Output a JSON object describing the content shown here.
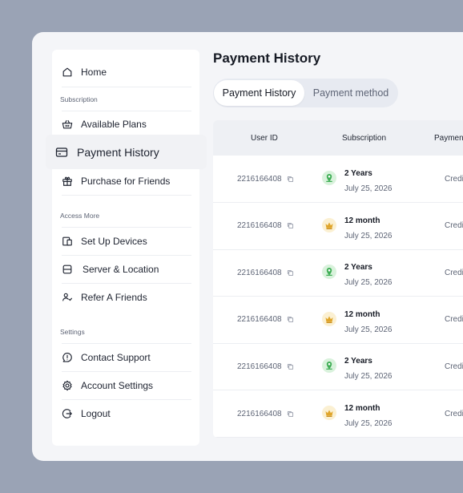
{
  "sidebar": {
    "home": "Home",
    "section_subscription": "Subscription",
    "available_plans": "Available Plans",
    "payment_history": "Payment History",
    "purchase_for_friends": "Purchase for Friends",
    "section_access_more": "Access More",
    "set_up_devices": "Set Up Devices",
    "server_location": "Server & Location",
    "refer_friends": "Refer A Friends",
    "section_settings": "Settings",
    "contact_support": "Contact Support",
    "account_settings": "Account Settings",
    "logout": "Logout"
  },
  "main": {
    "title": "Payment History",
    "tabs": [
      {
        "label": "Payment History",
        "active": true
      },
      {
        "label": "Payment method",
        "active": false
      }
    ],
    "table": {
      "headers": [
        "User ID",
        "Subscription",
        "Payment"
      ],
      "rows": [
        {
          "user_id": "2216166408",
          "plan": "2 Years",
          "date": "July 25, 2026",
          "badge": "green",
          "payment": "Credi"
        },
        {
          "user_id": "2216166408",
          "plan": "12 month",
          "date": "July 25, 2026",
          "badge": "gold",
          "payment": "Credi"
        },
        {
          "user_id": "2216166408",
          "plan": "2 Years",
          "date": "July 25, 2026",
          "badge": "green",
          "payment": "Credi"
        },
        {
          "user_id": "2216166408",
          "plan": "12 month",
          "date": "July 25, 2026",
          "badge": "gold",
          "payment": "Credi"
        },
        {
          "user_id": "2216166408",
          "plan": "2 Years",
          "date": "July 25, 2026",
          "badge": "green",
          "payment": "Credi"
        },
        {
          "user_id": "2216166408",
          "plan": "12 month",
          "date": "July 25, 2026",
          "badge": "gold",
          "payment": "Credi"
        }
      ]
    }
  },
  "colors": {
    "backdrop": "#9aa3b5",
    "panel": "#f4f5f8",
    "green_badge": "#4cb85c",
    "gold_badge": "#e0a52a"
  },
  "icons": {
    "green_badge": "location-pin-icon",
    "gold_badge": "crown-icon",
    "copy": "copy-icon"
  }
}
